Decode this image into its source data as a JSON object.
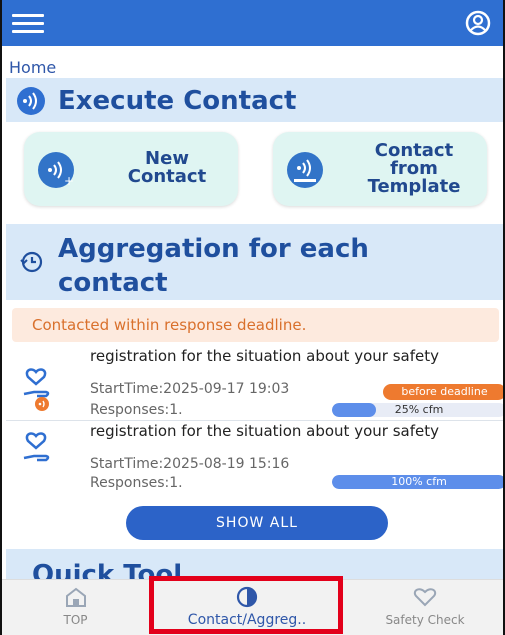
{
  "header": {
    "menu_icon": "hamburger-icon",
    "profile_icon": "user-circle-icon",
    "color": "#2f6fd1"
  },
  "breadcrumb": "Home",
  "execute": {
    "title": "Execute Contact",
    "new_contact": "New\nContact",
    "template": "Contact\nfrom\nTemplate"
  },
  "aggregation": {
    "title": "Aggregation for each contact",
    "notice": "Contacted within response deadline.",
    "items": [
      {
        "title": "registration for the situation about your safety",
        "start": "StartTime:2025-09-17 19:03",
        "responses": "Responses:1.",
        "badge": "before deadline",
        "progress_text": "25% cfm",
        "progress": 0.25
      },
      {
        "title": "registration for the situation about your safety",
        "start": "StartTime:2025-08-19 15:16",
        "responses": "Responses:1.",
        "progress_text": "100% cfm",
        "progress": 1.0
      }
    ],
    "show_all": "SHOW ALL"
  },
  "quick_tool": {
    "title": "Quick Tool"
  },
  "tabs": [
    {
      "label": "TOP",
      "icon": "home-icon"
    },
    {
      "label": "Contact/Aggreg..",
      "icon": "pie-chart-icon",
      "active": true
    },
    {
      "label": "Safety Check",
      "icon": "heart-icon"
    }
  ],
  "colors": {
    "accent": "#2f6fd1",
    "badge": "#ee7a2f",
    "highlight": "#e3001b"
  }
}
